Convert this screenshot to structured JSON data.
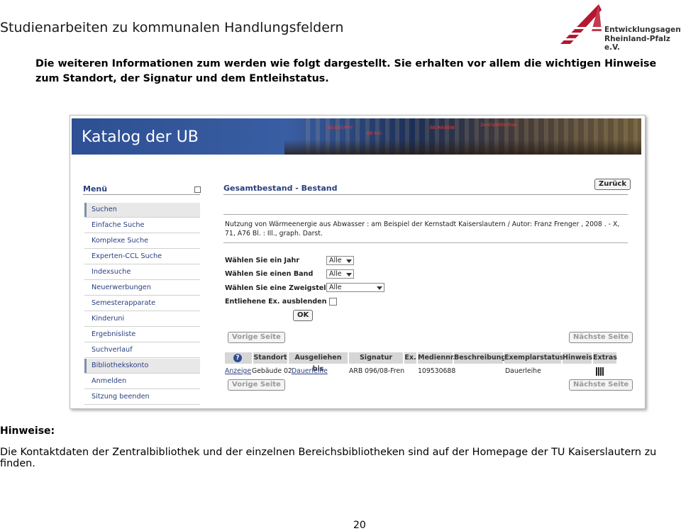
{
  "header": {
    "doc_title": "Studienarbeiten zu kommunalen Handlungsfeldern",
    "logo_line1": "Entwicklungsagentur",
    "logo_line2": "Rheinland-Pfalz e.V."
  },
  "intro": "Die weiteren Informationen zum werden wie folgt dargestellt. Sie erhalten vor allem die wichtigen Hinweise zum Standort, der Signatur und dem Entleihstatus.",
  "screenshot": {
    "banner_title": "Katalog der UB",
    "banner_tags": [
      "BB MAT/PHY",
      "BB ING",
      "BB MA/WIW",
      "Zentralbibliothek"
    ],
    "menu_title": "Menü",
    "menu_items": [
      "Suchen",
      "Einfache Suche",
      "Komplexe Suche",
      "Experten-CCL Suche",
      "Indexsuche",
      "Neuerwerbungen",
      "Semesterapparate",
      "Kinderuni",
      "Ergebnisliste",
      "Suchverlauf",
      "Bibliothekskonto",
      "Anmelden",
      "Sitzung beenden"
    ],
    "content_title": "Gesamtbestand - Bestand",
    "back_button": "Zurück",
    "description": "Nutzung von Wärmeenergie aus Abwasser  : am Beispiel der Kernstadt Kaiserslautern  / Autor: Franz Frenger , 2008 . - X, 71, A76 Bl. : Ill., graph. Darst.",
    "form": {
      "year_label": "Wählen Sie ein Jahr",
      "year_value": "Alle",
      "band_label": "Wählen Sie einen Band",
      "band_value": "Alle",
      "branch_label": "Wählen Sie eine Zweigstelle",
      "branch_value": "Alle",
      "hide_label": "Entliehene Ex. ausblenden",
      "ok_button": "OK"
    },
    "prev_page": "Vorige Seite",
    "next_page": "Nächste Seite",
    "table": {
      "help_icon": "?",
      "headers": [
        "Standort",
        "Ausgeliehen bis",
        "Signatur",
        "Ex.",
        "Mediennr.",
        "Beschreibung",
        "Exemplarstatus",
        "Hinweis",
        "Extras"
      ],
      "row": {
        "link": "Anzeige",
        "standort": "Gebäude 02",
        "ausgeliehen": "Dauerleihe",
        "signatur": "ARB 096/08-Fren",
        "mediennr": "109530688",
        "status": "Dauerleihe"
      }
    }
  },
  "hinweise_title": "Hinweise:",
  "hinweise_text": "Die Kontaktdaten der Zentralbibliothek und der einzelnen Bereichsbibliotheken sind auf der Homepage der TU Kaiserslautern zu finden.",
  "page_number": "20",
  "colors": {
    "banner_blue": "#2d4f93",
    "menu_text": "#2a3f80",
    "logo_red": "#b5172f"
  }
}
